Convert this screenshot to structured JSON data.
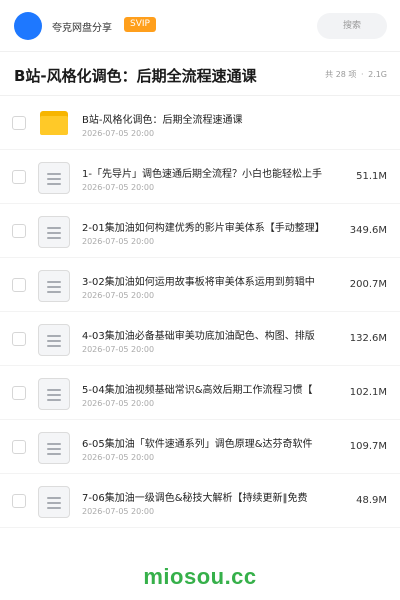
{
  "header": {
    "brand": "夸克网盘分享",
    "badge": "SVIP",
    "search_placeholder": "搜索"
  },
  "title_bar": {
    "title": "B站-风格化调色：后期全流程速通课",
    "count": "共 28 项",
    "total_size": "2.1G"
  },
  "files": [
    {
      "name": "B站-风格化调色：后期全流程速通课",
      "date": "2026-07-05 20:00",
      "size": "",
      "type": "folder"
    },
    {
      "name": "1-「先导片」调色速通后期全流程？小白也能轻松上手",
      "date": "2026-07-05 20:00",
      "size": "51.1M",
      "type": "file"
    },
    {
      "name": "2-01集加油如何构建优秀的影片审美体系【手动整理】",
      "date": "2026-07-05 20:00",
      "size": "349.6M",
      "type": "file"
    },
    {
      "name": "3-02集加油如何运用故事板将审美体系运用到剪辑中",
      "date": "2026-07-05 20:00",
      "size": "200.7M",
      "type": "file"
    },
    {
      "name": "4-03集加油必备基础审美功底加油配色、构图、排版",
      "date": "2026-07-05 20:00",
      "size": "132.6M",
      "type": "file"
    },
    {
      "name": "5-04集加油视频基础常识&高效后期工作流程习惯【",
      "date": "2026-07-05 20:00",
      "size": "102.1M",
      "type": "file"
    },
    {
      "name": "6-05集加油「软件速通系列」调色原理&达芬奇软件",
      "date": "2026-07-05 20:00",
      "size": "109.7M",
      "type": "file"
    },
    {
      "name": "7-06集加油一级调色&秘技大解析【持续更新‖免费",
      "date": "2026-07-05 20:00",
      "size": "48.9M",
      "type": "file"
    }
  ],
  "footer": {
    "watermark": "miosou.cc"
  },
  "colors": {
    "accent": "#1e78ff",
    "badge": "#ff9f1c",
    "folder": "#ffc928",
    "watermark": "#36b04a"
  }
}
